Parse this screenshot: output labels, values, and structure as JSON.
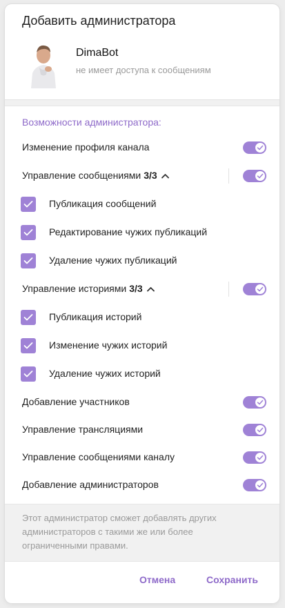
{
  "dialog": {
    "title": "Добавить администратора",
    "bot": {
      "name": "DimaBot",
      "status": "не имеет доступа к сообщениям"
    },
    "section_title": "Возможности администратора:",
    "rows": [
      {
        "label": "Изменение профиля канала",
        "enabled": true
      },
      {
        "label": "Управление сообщениями",
        "count": "3/3",
        "expanded": true,
        "enabled": true
      },
      {
        "label": "Управление историями",
        "count": "3/3",
        "expanded": true,
        "enabled": true
      },
      {
        "label": "Добавление участников",
        "enabled": true
      },
      {
        "label": "Управление трансляциями",
        "enabled": true
      },
      {
        "label": "Управление сообщениями каналу",
        "enabled": true
      },
      {
        "label": "Добавление администраторов",
        "enabled": true
      }
    ],
    "messages_sub": [
      {
        "label": "Публикация сообщений",
        "checked": true
      },
      {
        "label": "Редактирование чужих публикаций",
        "checked": true
      },
      {
        "label": "Удаление чужих публикаций",
        "checked": true
      }
    ],
    "stories_sub": [
      {
        "label": "Публикация историй",
        "checked": true
      },
      {
        "label": "Изменение чужих историй",
        "checked": true
      },
      {
        "label": "Удаление чужих историй",
        "checked": true
      }
    ],
    "footer_note": "Этот администратор сможет добавлять других администраторов с такими же или более ограниченными правами.",
    "cancel_label": "Отмена",
    "save_label": "Сохранить"
  },
  "colors": {
    "accent": "#9f82d6",
    "accent_text": "#8e6ac9"
  },
  "icons": {
    "toggle_knob": "check-icon",
    "checkbox": "check-icon",
    "expand": "chevron-up-icon"
  }
}
